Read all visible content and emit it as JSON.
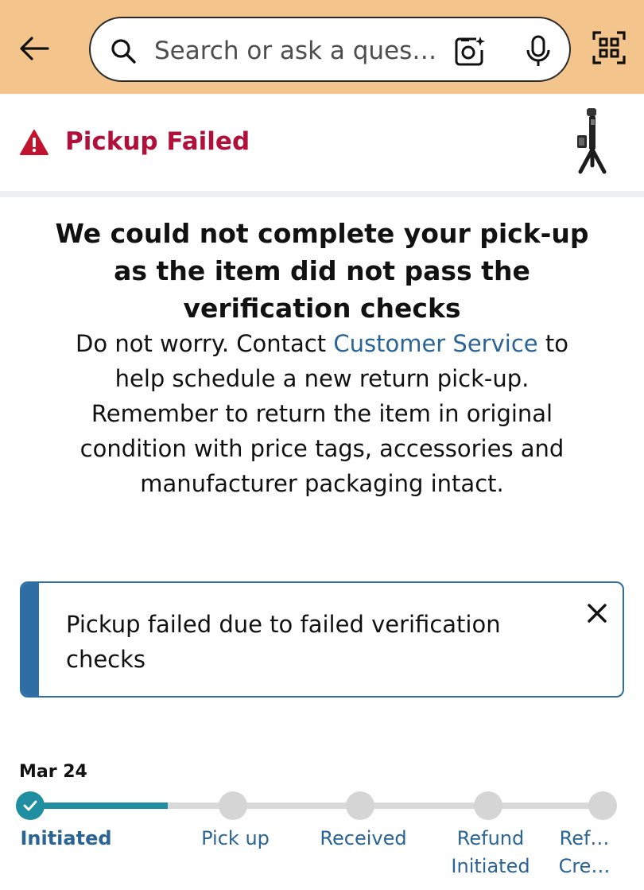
{
  "header": {
    "search_placeholder": "Search or ask a ques…"
  },
  "status": {
    "title": "Pickup Failed"
  },
  "headline": "We could not complete your pick-up as the item did not pass the verification checks",
  "message": {
    "before": "Do not worry. Contact ",
    "link": "Customer Service",
    "after": " to help schedule a new return pick-up. Remember to return the item in original condition with price tags, accessories and manufacturer packaging intact."
  },
  "alert": {
    "text": "Pickup failed due to failed verification checks"
  },
  "tracker": {
    "date": "Mar 24",
    "progress_fraction": 0.24,
    "steps": [
      {
        "label": "Initiated",
        "status": "done"
      },
      {
        "label": "Pick up",
        "status": "pending"
      },
      {
        "label": "Received",
        "status": "pending"
      },
      {
        "label": "Refund Initiated",
        "status": "pending"
      },
      {
        "label": "Ref… Cre…",
        "status": "pending"
      }
    ]
  },
  "colors": {
    "header_bg": "#f3c48c",
    "alert_red": "#b0103a",
    "link_blue": "#2a6496",
    "progress_teal": "#1e8ea0"
  }
}
